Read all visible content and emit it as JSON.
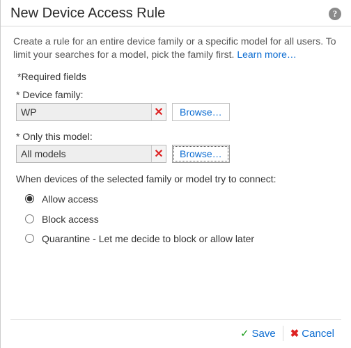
{
  "header": {
    "title": "New Device Access Rule"
  },
  "intro": {
    "text": "Create a rule for an entire device family or a specific model for all users. To limit your searches for a model, pick the family first. ",
    "learn_more": "Learn more…"
  },
  "required_fields_label": "*Required fields",
  "device_family": {
    "label": "* Device family:",
    "value": "WP",
    "browse": "Browse…"
  },
  "only_model": {
    "label": "* Only this model:",
    "value": "All models",
    "browse": "Browse…"
  },
  "when_connect": "When devices of the selected family or model try to connect:",
  "radios": {
    "allow": "Allow access",
    "block": "Block access",
    "quarantine": "Quarantine - Let me decide to block or allow later",
    "selected": "allow"
  },
  "footer": {
    "save": "Save",
    "cancel": "Cancel"
  }
}
